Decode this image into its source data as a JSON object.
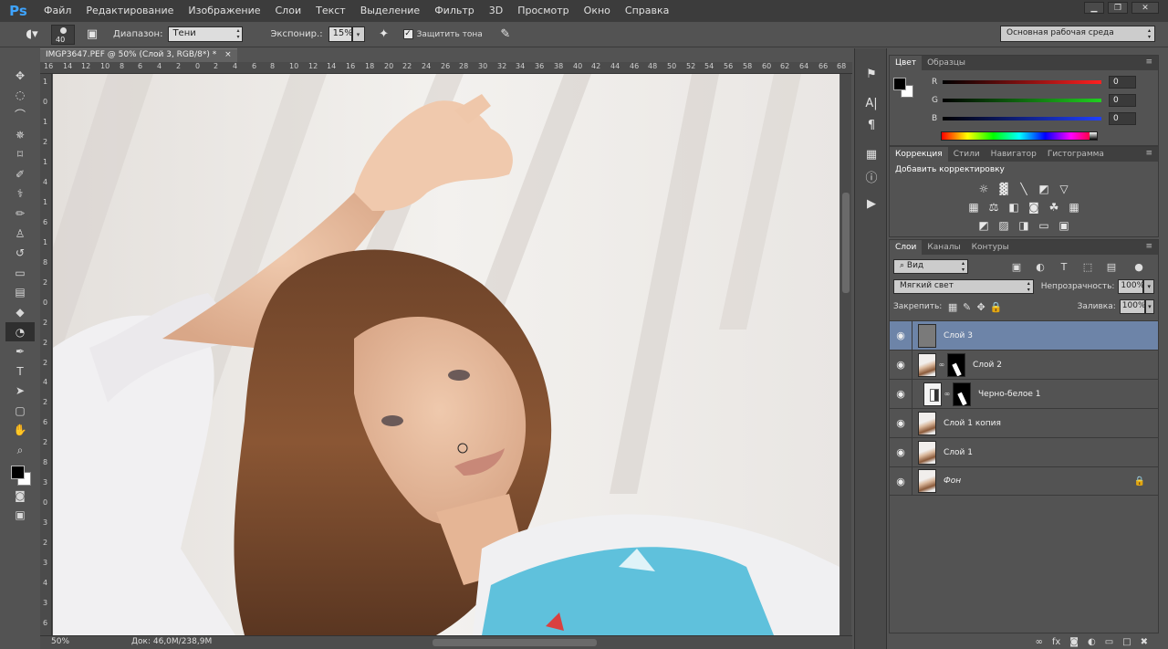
{
  "app": {
    "logo": "Ps",
    "menu": [
      "Файл",
      "Редактирование",
      "Изображение",
      "Слои",
      "Текст",
      "Выделение",
      "Фильтр",
      "3D",
      "Просмотр",
      "Окно",
      "Справка"
    ]
  },
  "window_controls": [
    "minimize-icon",
    "restore-icon",
    "close-icon"
  ],
  "options": {
    "brush_size": "40",
    "range_label": "Диапазон:",
    "range_value": "Тени",
    "exposure_label": "Экспонир.:",
    "exposure_value": "15%",
    "protect_tones_label": "Защитить тона",
    "protect_tones_checked": true,
    "workspace": "Основная рабочая среда"
  },
  "tools": [
    "move-tool",
    "marquee-tool",
    "lasso-tool",
    "quick-select-tool",
    "crop-tool",
    "eyedropper-tool",
    "healing-tool",
    "brush-tool",
    "stamp-tool",
    "history-brush-tool",
    "eraser-tool",
    "gradient-tool",
    "blur-tool",
    "dodge-tool",
    "pen-tool",
    "type-tool",
    "path-select-tool",
    "shape-tool",
    "hand-tool",
    "zoom-tool"
  ],
  "document": {
    "tab_title": "IMGP3647.PEF @ 50% (Слой 3, RGB/8*) *",
    "tab_close": "×",
    "ruler_top": [
      "16",
      "14",
      "12",
      "10",
      "8",
      "6",
      "4",
      "2",
      "0",
      "2",
      "4",
      "6",
      "8",
      "10",
      "12",
      "14",
      "16",
      "18",
      "20",
      "22",
      "24",
      "26",
      "28",
      "30",
      "32",
      "34",
      "36",
      "38",
      "40",
      "42",
      "44",
      "46",
      "48",
      "50",
      "52",
      "54",
      "56",
      "58",
      "60",
      "62",
      "64",
      "66",
      "68"
    ],
    "ruler_left": [
      "1",
      "0",
      "1",
      "2",
      "1",
      "4",
      "1",
      "6",
      "1",
      "8",
      "2",
      "0",
      "2",
      "2",
      "2",
      "4",
      "2",
      "6",
      "2",
      "8",
      "3",
      "0",
      "3",
      "2",
      "3",
      "4",
      "3",
      "6"
    ],
    "zoom": "50%",
    "doc_info": "Док: 46,0M/238,9M"
  },
  "color_panel": {
    "tabs": [
      "Цвет",
      "Образцы"
    ],
    "rows": [
      {
        "label": "R",
        "value": "0",
        "color": "#ff3030"
      },
      {
        "label": "G",
        "value": "0",
        "color": "#30c030"
      },
      {
        "label": "B",
        "value": "0",
        "color": "#3050ff"
      }
    ],
    "foreground": "#000000",
    "background": "#ffffff"
  },
  "adjustments_panel": {
    "tabs": [
      "Коррекция",
      "Стили",
      "Навигатор",
      "Гистограмма"
    ],
    "title": "Добавить корректировку"
  },
  "layers_panel": {
    "tabs": [
      "Слои",
      "Каналы",
      "Контуры"
    ],
    "filter": "Вид",
    "blend_mode": "Мягкий свет",
    "opacity_label": "Непрозрачность:",
    "opacity": "100%",
    "lock_label": "Закрепить:",
    "fill_label": "Заливка:",
    "fill": "100%",
    "layers": [
      {
        "name": "Слой 3",
        "selected": true
      },
      {
        "name": "Слой 2",
        "selected": false
      },
      {
        "name": "Черно-белое 1",
        "selected": false
      },
      {
        "name": "Слой 1 копия",
        "selected": false
      },
      {
        "name": "Слой 1",
        "selected": false
      },
      {
        "name": "Фон",
        "selected": false,
        "locked": true
      }
    ]
  }
}
